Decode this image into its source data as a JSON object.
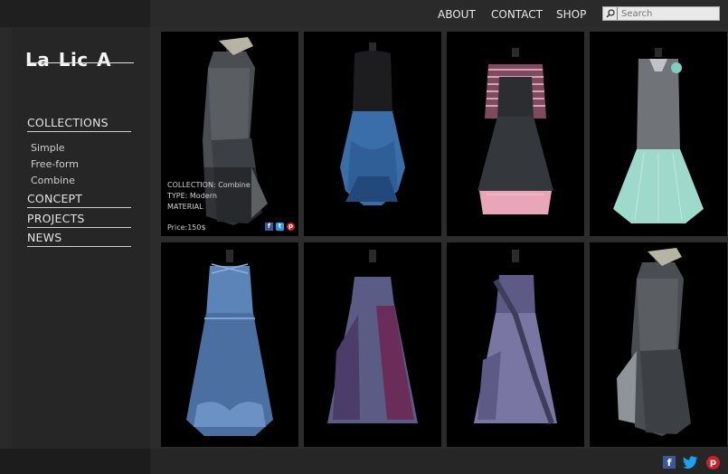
{
  "nav": {
    "about": "ABOUT",
    "contact": "CONTACT",
    "shop": "SHOP"
  },
  "search": {
    "placeholder": "Search"
  },
  "logo": {
    "text": "La Lic A"
  },
  "sidebar": {
    "collections": "COLLECTIONS",
    "sub": [
      "Simple",
      "Free-form",
      "Combine"
    ],
    "concept": "CONCEPT",
    "projects": "PROJECTS",
    "news": "NEWS"
  },
  "product_overlay": {
    "collection": "COLLECTION: Combine",
    "type": "TYPE: Modern",
    "material": "MATERIAL",
    "price": "Price:150$"
  },
  "products": [
    {
      "dress": "grey-asymmetric-dress",
      "colors": [
        "#4a4d52",
        "#6a6e73",
        "#9aa0a4"
      ]
    },
    {
      "dress": "blue-bubble-dress",
      "colors": [
        "#1f1f22",
        "#3a6ea8",
        "#2a5487"
      ]
    },
    {
      "dress": "striped-pinafore-dress",
      "colors": [
        "#2b2d30",
        "#e8a6b8",
        "#8a5d70"
      ]
    },
    {
      "dress": "grey-mint-dress",
      "colors": [
        "#707478",
        "#9fd9cc",
        "#c0c4c7"
      ]
    },
    {
      "dress": "blue-gathered-dress",
      "colors": [
        "#5b84b8",
        "#4a6fa0",
        "#6c92c4"
      ]
    },
    {
      "dress": "purple-ruffle-dress",
      "colors": [
        "#4b3d6a",
        "#6a2d5a",
        "#5a5c86"
      ]
    },
    {
      "dress": "lilac-ruffle-dress",
      "colors": [
        "#5e5a86",
        "#7a76a4",
        "#3f3d5c"
      ]
    },
    {
      "dress": "grey-asymmetric-dress-2",
      "colors": [
        "#4a4d52",
        "#6a6e73",
        "#9aa0a4"
      ]
    }
  ],
  "colors": {
    "fb": "#3b5998",
    "tw": "#1da1f2",
    "pin": "#cb2027"
  }
}
